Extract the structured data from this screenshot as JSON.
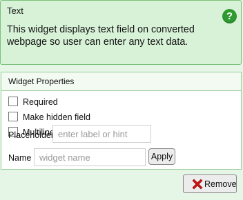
{
  "header": {
    "title": "Text",
    "help_icon": "?",
    "description": "This widget displays text field on converted webpage so user can enter any text data."
  },
  "properties": {
    "title": "Widget Properties",
    "checkboxes": [
      {
        "label": "Required",
        "checked": false
      },
      {
        "label": "Make hidden field",
        "checked": false
      },
      {
        "label": "Multiline",
        "checked": false
      }
    ],
    "placeholder": {
      "label": "Placeholder",
      "value": "",
      "hint": "enter label or hint"
    },
    "name": {
      "label": "Name",
      "value": "",
      "hint": "widget name"
    },
    "apply_label": "Apply"
  },
  "actions": {
    "remove_label": "Remove",
    "remove_icon": "red-x-icon"
  },
  "colors": {
    "background": "#e6f6e6",
    "header_bg": "#d8f2d8",
    "border": "#79c079",
    "help_icon": "#2f9a2f",
    "remove_icon": "#d11010"
  }
}
